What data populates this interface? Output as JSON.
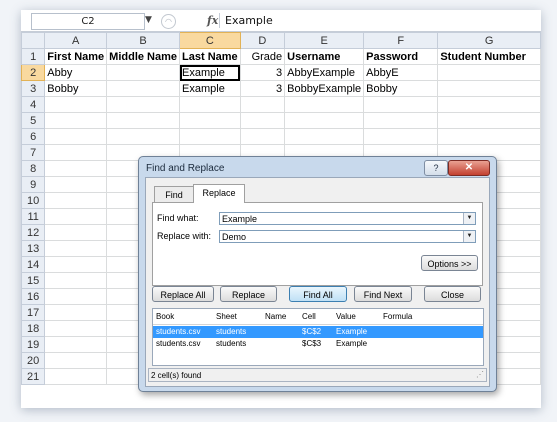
{
  "formula_bar": {
    "name_box": "C2",
    "fx_label": "fx",
    "value": "Example"
  },
  "sheet": {
    "columns": [
      "A",
      "B",
      "C",
      "D",
      "E",
      "F",
      "G"
    ],
    "selected_column": "C",
    "selected_row": 2,
    "rows": [
      {
        "n": "1",
        "cells": [
          "First Name",
          "Middle Name",
          "Last Name",
          "Grade",
          "Username",
          "Password",
          "Student Number"
        ]
      },
      {
        "n": "2",
        "cells": [
          "Abby",
          "",
          "Example",
          "3",
          "AbbyExample",
          "AbbyE",
          ""
        ]
      },
      {
        "n": "3",
        "cells": [
          "Bobby",
          "",
          "Example",
          "3",
          "BobbyExample",
          "Bobby",
          ""
        ]
      },
      {
        "n": "4",
        "cells": [
          "",
          "",
          "",
          "",
          "",
          "",
          ""
        ]
      },
      {
        "n": "5",
        "cells": [
          "",
          "",
          "",
          "",
          "",
          "",
          ""
        ]
      },
      {
        "n": "6",
        "cells": [
          "",
          "",
          "",
          "",
          "",
          "",
          ""
        ]
      },
      {
        "n": "7",
        "cells": [
          "",
          "",
          "",
          "",
          "",
          "",
          ""
        ]
      },
      {
        "n": "8",
        "cells": [
          "",
          "",
          "",
          "",
          "",
          "",
          ""
        ]
      },
      {
        "n": "9",
        "cells": [
          "",
          "",
          "",
          "",
          "",
          "",
          ""
        ]
      },
      {
        "n": "10",
        "cells": [
          "",
          "",
          "",
          "",
          "",
          "",
          ""
        ]
      },
      {
        "n": "11",
        "cells": [
          "",
          "",
          "",
          "",
          "",
          "",
          ""
        ]
      },
      {
        "n": "12",
        "cells": [
          "",
          "",
          "",
          "",
          "",
          "",
          ""
        ]
      },
      {
        "n": "13",
        "cells": [
          "",
          "",
          "",
          "",
          "",
          "",
          ""
        ]
      },
      {
        "n": "14",
        "cells": [
          "",
          "",
          "",
          "",
          "",
          "",
          ""
        ]
      },
      {
        "n": "15",
        "cells": [
          "",
          "",
          "",
          "",
          "",
          "",
          ""
        ]
      },
      {
        "n": "16",
        "cells": [
          "",
          "",
          "",
          "",
          "",
          "",
          ""
        ]
      },
      {
        "n": "17",
        "cells": [
          "",
          "",
          "",
          "",
          "",
          "",
          ""
        ]
      },
      {
        "n": "18",
        "cells": [
          "",
          "",
          "",
          "",
          "",
          "",
          ""
        ]
      },
      {
        "n": "19",
        "cells": [
          "",
          "",
          "",
          "",
          "",
          "",
          ""
        ]
      },
      {
        "n": "20",
        "cells": [
          "",
          "",
          "",
          "",
          "",
          "",
          ""
        ]
      },
      {
        "n": "21",
        "cells": [
          "",
          "",
          "",
          "",
          "",
          "",
          ""
        ]
      }
    ]
  },
  "dialog": {
    "title": "Find and Replace",
    "help_label": "?",
    "close_label": "✕",
    "tabs": {
      "find": "Find",
      "replace": "Replace"
    },
    "find_what_label": "Find what:",
    "find_what_value": "Example",
    "replace_with_label": "Replace with:",
    "replace_with_value": "Demo",
    "options_label": "Options >>",
    "buttons": {
      "replace_all": "Replace All",
      "replace": "Replace",
      "find_all": "Find All",
      "find_next": "Find Next",
      "close": "Close"
    },
    "results": {
      "headers": [
        "Book",
        "Sheet",
        "Name",
        "Cell",
        "Value",
        "Formula"
      ],
      "rows": [
        {
          "book": "students.csv",
          "sheet": "students",
          "name": "",
          "cell": "$C$2",
          "value": "Example",
          "formula": ""
        },
        {
          "book": "students.csv",
          "sheet": "students",
          "name": "",
          "cell": "$C$3",
          "value": "Example",
          "formula": ""
        }
      ]
    },
    "status": "2 cell(s) found"
  }
}
